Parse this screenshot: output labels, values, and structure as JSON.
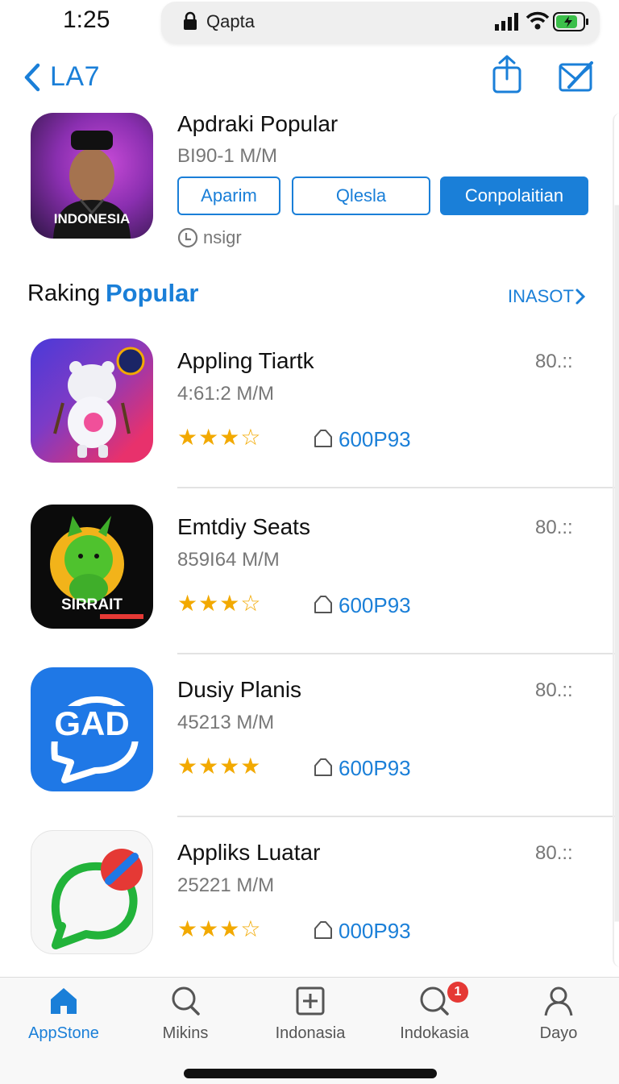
{
  "status": {
    "time": "1:25",
    "url": "Qapta"
  },
  "nav": {
    "back_label": "LA7"
  },
  "featured": {
    "title": "Apdraki Popular",
    "subtitle": "BI90-1 M/M",
    "icon_tag": "INDONESIA",
    "chips": [
      "Aparim",
      "Qlesla",
      "Conpolaitian"
    ],
    "meta": "nsigr"
  },
  "section": {
    "title_part1": "Raking",
    "title_part2": "Popular",
    "link": "INASOT"
  },
  "apps": [
    {
      "name": "Appling Tiartk",
      "size": "4:61:2 M/M",
      "rating": 3,
      "count": "600P93",
      "score": "80.::"
    },
    {
      "name": "Emtdiy Seats",
      "size": "859I64 M/M",
      "rating": 3,
      "count": "600P93",
      "score": "80.::",
      "icon_text": "SIRRAIT"
    },
    {
      "name": "Dusiy Planis",
      "size": "45213 M/M",
      "rating": 4,
      "count": "600P93",
      "score": "80.::",
      "icon_text": "GAD"
    },
    {
      "name": "Appliks Luatar",
      "size": "25221 M/M",
      "rating": 3,
      "count": "000P93",
      "score": "80.::"
    }
  ],
  "tabs": [
    {
      "label": "AppStone",
      "icon": "home-icon",
      "active": true
    },
    {
      "label": "Mikins",
      "icon": "search-icon"
    },
    {
      "label": "Indonasia",
      "icon": "plus-square-icon"
    },
    {
      "label": "Indokasia",
      "icon": "search-badge-icon",
      "badge": "1"
    },
    {
      "label": "Dayo",
      "icon": "person-icon"
    }
  ],
  "colors": {
    "accent": "#1a7fd8",
    "star": "#f2a900",
    "badge": "#e53935"
  }
}
